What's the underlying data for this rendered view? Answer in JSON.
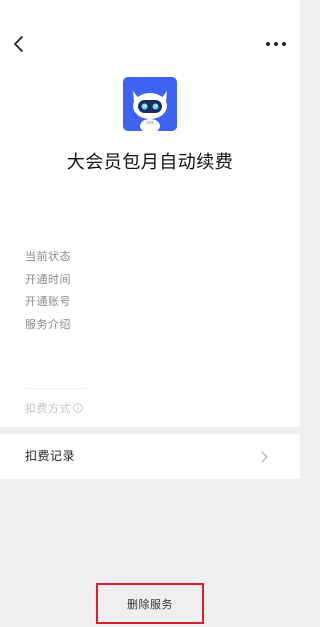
{
  "nav": {
    "back_icon": "chevron-left-icon",
    "more_icon": "more-horizontal-icon"
  },
  "service": {
    "logo_icon": "robot-mascot-icon",
    "title": "大会员包月自动续费"
  },
  "info": {
    "items": [
      "当前状态",
      "开通时间",
      "开通账号",
      "服务介绍"
    ],
    "payment_method_label": "扣费方式",
    "payment_method_icon": "info-circle-icon"
  },
  "records": {
    "label": "扣费记录",
    "chevron_icon": "chevron-right-icon"
  },
  "footer": {
    "delete_label": "删除服务"
  },
  "colors": {
    "logo_background": "#3d63f2",
    "page_background": "#efefef",
    "highlight_border": "#d61f2a"
  }
}
